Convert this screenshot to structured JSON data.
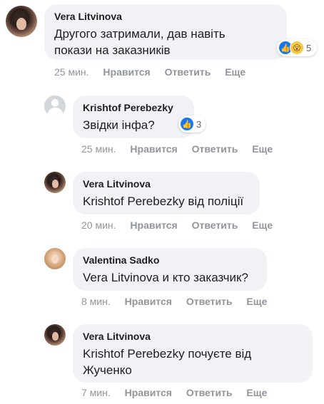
{
  "comments": [
    {
      "author": "Vera Litvinova",
      "text": "Другого затримали, дав навіть покази на заказників",
      "time": "25 мин.",
      "like": "Нравится",
      "reply": "Ответить",
      "more": "Еще",
      "reactions": {
        "icons": [
          "like-icon",
          "wow-icon"
        ],
        "count": "5"
      }
    },
    {
      "author": "Krishtof Perebezky",
      "text": "Звідки інфа?",
      "time": "25 мин.",
      "like": "Нравится",
      "reply": "Ответить",
      "more": "Еще",
      "reactions": {
        "icons": [
          "like-icon"
        ],
        "count": "3"
      }
    },
    {
      "author": "Vera Litvinova",
      "text": "Krishtof Perebezky від поліції",
      "time": "20 мин.",
      "like": "Нравится",
      "reply": "Ответить",
      "more": "Еще"
    },
    {
      "author": "Valentina Sadko",
      "text": "Vera Litvinova и кто заказчик?",
      "time": "8 мин.",
      "like": "Нравится",
      "reply": "Ответить",
      "more": "Еще"
    },
    {
      "author": "Vera Litvinova",
      "text": "Krishtof Perebezky почуєте від Жученко",
      "time": "7 мин.",
      "like": "Нравится",
      "reply": "Ответить",
      "more": "Еще"
    }
  ],
  "colors": {
    "bubble": "#f0f2f5",
    "meta": "#90949c",
    "like": "#1877f2"
  }
}
